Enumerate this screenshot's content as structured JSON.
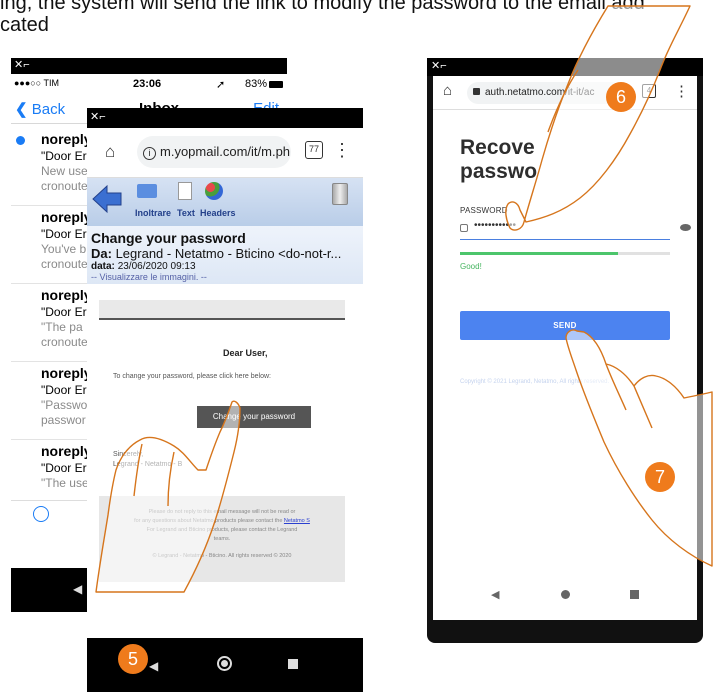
{
  "caption": {
    "line1": "ing, the system will send the link to modify the password to the email add",
    "line2": "cated"
  },
  "mail_app": {
    "status": {
      "carrier": "●●●○○ TIM",
      "time": "23:06",
      "battery": "83%"
    },
    "nav": {
      "back": "Back",
      "title": "Inbox",
      "edit": "Edit"
    },
    "items": [
      {
        "from": "noreply",
        "subject": "\"Door Er",
        "preview1": "New use",
        "preview2": "cronoute"
      },
      {
        "from": "noreply",
        "subject": "\"Door Er",
        "preview1": "You've b",
        "preview2": "cronoute"
      },
      {
        "from": "noreply",
        "subject": "\"Door Er",
        "preview1": "\"The pa",
        "preview2": "cronoute"
      },
      {
        "from": "noreply",
        "subject": "\"Door Er",
        "preview1": "\"Passwo",
        "preview2": "passwor"
      },
      {
        "from": "noreply",
        "subject": "\"Door Er",
        "preview1": "\"The use",
        "preview2": ""
      }
    ]
  },
  "yopmail": {
    "url": "m.yopmail.com/it/m.ph",
    "tab_count": "77",
    "toolbar": {
      "forward": "Inoltrare",
      "text": "Text",
      "headers": "Headers"
    },
    "subject": "Change your password",
    "from_label": "Da:",
    "from_value": "Legrand - Netatmo - Bticino <do-not-r...",
    "date_label": "data:",
    "date_value": "23/06/2020 09:13",
    "show_images": "-- Visualizzare le immagini. --",
    "body": {
      "greeting": "Dear User,",
      "instruction": "To change your password, please click here below:",
      "button": "Change your password",
      "closing": "Sincerely,",
      "signature": "Legrand - Netatmo - B",
      "footer_line1": "Please do not reply to this email message will not be read or",
      "footer_line2": "for any questions about Netatmo products please contact the",
      "footer_link": "Netatmo S",
      "footer_line3": "For Legrand and Bticino products, please contact the Legrand",
      "footer_line4": "teams.",
      "footer_copyright": "© Legrand - Netatmo - Bticino. All rights reserved © 2020"
    }
  },
  "recover": {
    "url": "auth.netatmo.com/it-it/ac",
    "tab_count": "4",
    "title_line1": "Recove",
    "title_line2": "passwo",
    "password_label": "PASSWORD",
    "password_value": "••••••••••••",
    "strength": 0.75,
    "strength_text": "Good!",
    "send": "SEND",
    "copyright": "Copyright © 2021 Legrand, Netatmo, All rights reserved."
  },
  "steps": {
    "s5": "5",
    "s6": "6",
    "s7": "7"
  },
  "colors": {
    "badge": "#ef7b1c",
    "ios_blue": "#1a7cf5",
    "send_blue": "#4c83f0",
    "good_green": "#4cc56b"
  }
}
